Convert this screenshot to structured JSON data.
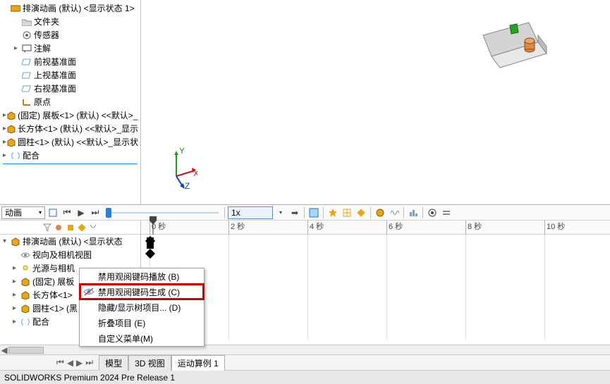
{
  "tree": {
    "top_truncated": "排演动画 (默认) <显示状态 1>",
    "items": [
      {
        "label": "文件夹",
        "icon": "folder"
      },
      {
        "label": "传感器",
        "icon": "sensor"
      },
      {
        "label": "注解",
        "icon": "annotation",
        "expandable": true
      },
      {
        "label": "前视基准面",
        "icon": "plane",
        "indent": true
      },
      {
        "label": "上视基准面",
        "icon": "plane",
        "indent": true
      },
      {
        "label": "右视基准面",
        "icon": "plane",
        "indent": true
      },
      {
        "label": "原点",
        "icon": "origin",
        "indent": true
      },
      {
        "label": "(固定) 展板<1> (默认) <<默认>_",
        "icon": "part-gold",
        "expandable": true
      },
      {
        "label": "长方体<1> (默认) <<默认>_显示",
        "icon": "part-gold",
        "expandable": true
      },
      {
        "label": "圆柱<1> (默认) <<默认>_显示状",
        "icon": "part-gold",
        "expandable": true
      },
      {
        "label": "配合",
        "icon": "mate",
        "expandable": true
      }
    ]
  },
  "timeline": {
    "dropdown_label": "动画",
    "speed_value": "1x",
    "ruler": [
      "0 秒",
      "2 秒",
      "4 秒",
      "6 秒",
      "8 秒",
      "10 秒"
    ],
    "tree": [
      {
        "label": "排演动画 (默认) <显示状态",
        "icon": "part-gold",
        "expandable": true
      },
      {
        "label": "视向及相机视图",
        "icon": "view",
        "indent": 1
      },
      {
        "label": "光源与相机",
        "icon": "light",
        "indent": 1,
        "cut": true,
        "expandable": true
      },
      {
        "label": "(固定) 展板",
        "icon": "part-gold",
        "indent": 1,
        "cut": true,
        "expandable": true
      },
      {
        "label": "长方体<1>",
        "icon": "part-gold",
        "indent": 1,
        "cut": true,
        "expandable": true
      },
      {
        "label": "圆柱<1> (黑",
        "icon": "part-gold",
        "indent": 1,
        "cut": true,
        "expandable": true
      },
      {
        "label": "配合",
        "icon": "mate",
        "indent": 1,
        "expandable": true
      }
    ]
  },
  "context_menu": {
    "items": [
      {
        "label": "禁用观阅键码播放 (B)",
        "highlight": false
      },
      {
        "label": "禁用观阅键码生成 (C)",
        "highlight": true,
        "icon": "eye-off"
      },
      {
        "label": "隐藏/显示树项目... (D)",
        "highlight": false
      },
      {
        "label": "折叠项目 (E)",
        "highlight": false
      },
      {
        "label": "自定义菜单(M)",
        "highlight": false
      }
    ]
  },
  "tabs": {
    "items": [
      "模型",
      "3D 视图",
      "运动算例 1"
    ],
    "active": 2
  },
  "status_bar": "SOLIDWORKS Premium 2024 Pre Release 1",
  "icons": {
    "folder": "folder-icon",
    "sensor": "sensor-icon",
    "annotation": "annotation-icon",
    "plane": "plane-icon",
    "origin": "origin-icon",
    "part-gold": "part-icon",
    "mate": "mate-icon",
    "view": "view-icon",
    "light": "light-icon",
    "eye-off": "eye-off-icon"
  },
  "chart_data": null
}
